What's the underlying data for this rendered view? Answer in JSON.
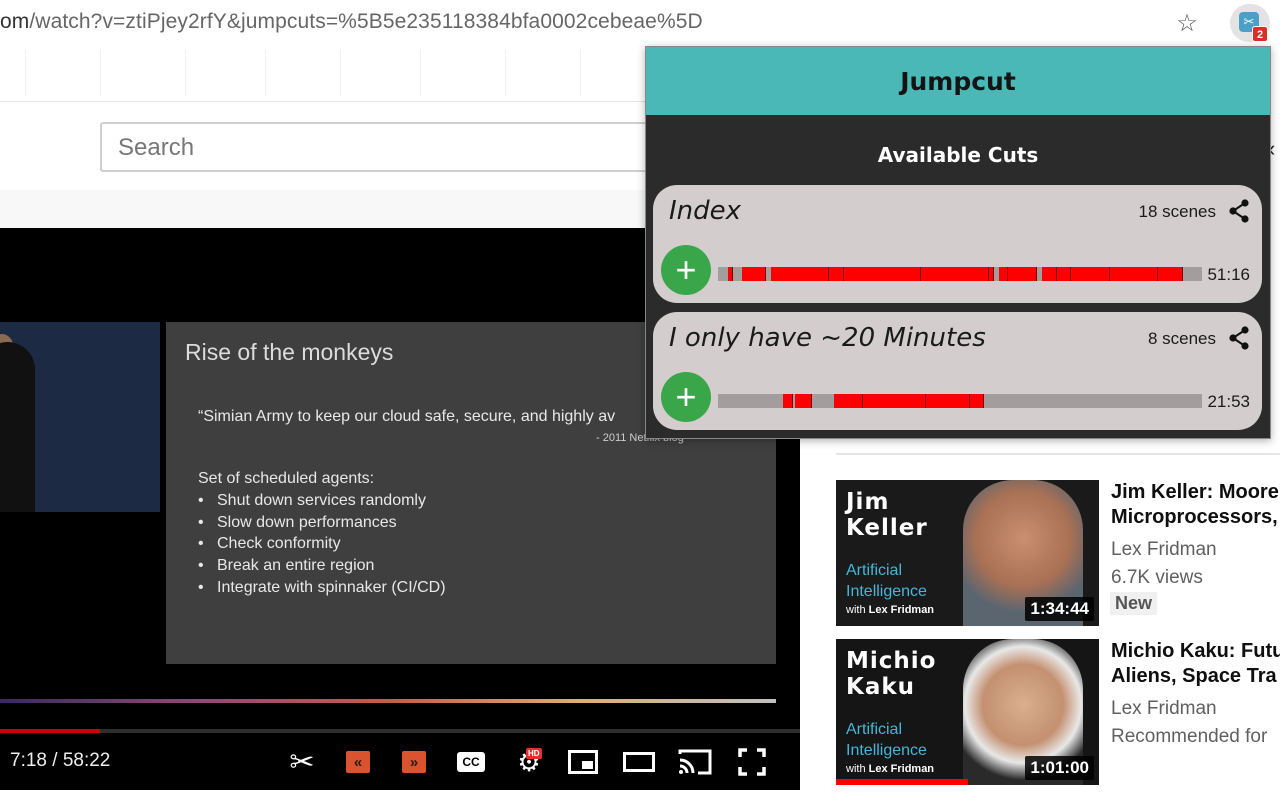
{
  "browser": {
    "url_host": "om",
    "url_path": "/watch?v=ztiPjey2rfY&jumpcuts=%5B5e235118384bfa0002cebeae%5D",
    "extension_badge": "2",
    "icons": {
      "bookmark": "star-icon",
      "extension": "jumpcut-extension-icon"
    }
  },
  "youtube": {
    "search_placeholder": "Search"
  },
  "video": {
    "slide": {
      "title": "Rise of the monkeys",
      "quote": "“Simian Army to keep our cloud safe, secure, and highly av",
      "quote_source": "- 2011 Netflix blog",
      "agents_heading": "Set of scheduled agents:",
      "bullets": [
        "Shut down services randomly",
        "Slow down performances",
        "Check conformity",
        "Break an entire region",
        "Integrate with spinnaker (CI/CD)"
      ]
    },
    "time": "7:18 / 58:22",
    "progress_fraction": 0.125,
    "controls": {
      "hd_badge": "HD",
      "cc_label": "CC",
      "rewind_glyph": "«",
      "forward_glyph": "»"
    }
  },
  "sidebar": {
    "recommendations": [
      {
        "thumb_name_line1": "Jim",
        "thumb_name_line2": "Keller",
        "thumb_ai_line1": "Artificial",
        "thumb_ai_line2": "Intelligence",
        "thumb_with": "with",
        "thumb_host": "Lex Fridman",
        "duration": "1:34:44",
        "title_line1": "Jim Keller: Moore",
        "title_line2": "Microprocessors,",
        "channel": "Lex Fridman",
        "views": "6.7K views",
        "badge": "New",
        "watched_fraction": 0
      },
      {
        "thumb_name_line1": "Michio",
        "thumb_name_line2": "Kaku",
        "thumb_ai_line1": "Artificial",
        "thumb_ai_line2": "Intelligence",
        "thumb_with": "with",
        "thumb_host": "Lex Fridman",
        "duration": "1:01:00",
        "title_line1": "Michio Kaku: Futu",
        "title_line2": "Aliens, Space Tra",
        "channel": "Lex Fridman",
        "views": "Recommended for",
        "watched_fraction": 0.5
      }
    ]
  },
  "popup": {
    "title": "Jumpcut",
    "subtitle": "Available Cuts",
    "accent_color": "#4bb8b8",
    "cuts": [
      {
        "name": "Index",
        "scenes": "18 scenes",
        "duration": "51:16",
        "segments": [
          [
            0.02,
            0.03
          ],
          [
            0.05,
            0.1
          ],
          [
            0.11,
            0.23
          ],
          [
            0.23,
            0.26
          ],
          [
            0.26,
            0.42
          ],
          [
            0.42,
            0.56
          ],
          [
            0.56,
            0.57
          ],
          [
            0.58,
            0.6
          ],
          [
            0.6,
            0.66
          ],
          [
            0.67,
            0.7
          ],
          [
            0.7,
            0.73
          ],
          [
            0.73,
            0.81
          ],
          [
            0.81,
            0.91
          ],
          [
            0.91,
            0.96
          ]
        ]
      },
      {
        "name": "I only have ~20 Minutes",
        "scenes": "8 scenes",
        "duration": "21:53",
        "segments": [
          [
            0.135,
            0.155
          ],
          [
            0.16,
            0.195
          ],
          [
            0.24,
            0.3
          ],
          [
            0.3,
            0.43
          ],
          [
            0.43,
            0.52
          ],
          [
            0.52,
            0.55
          ]
        ]
      }
    ]
  }
}
